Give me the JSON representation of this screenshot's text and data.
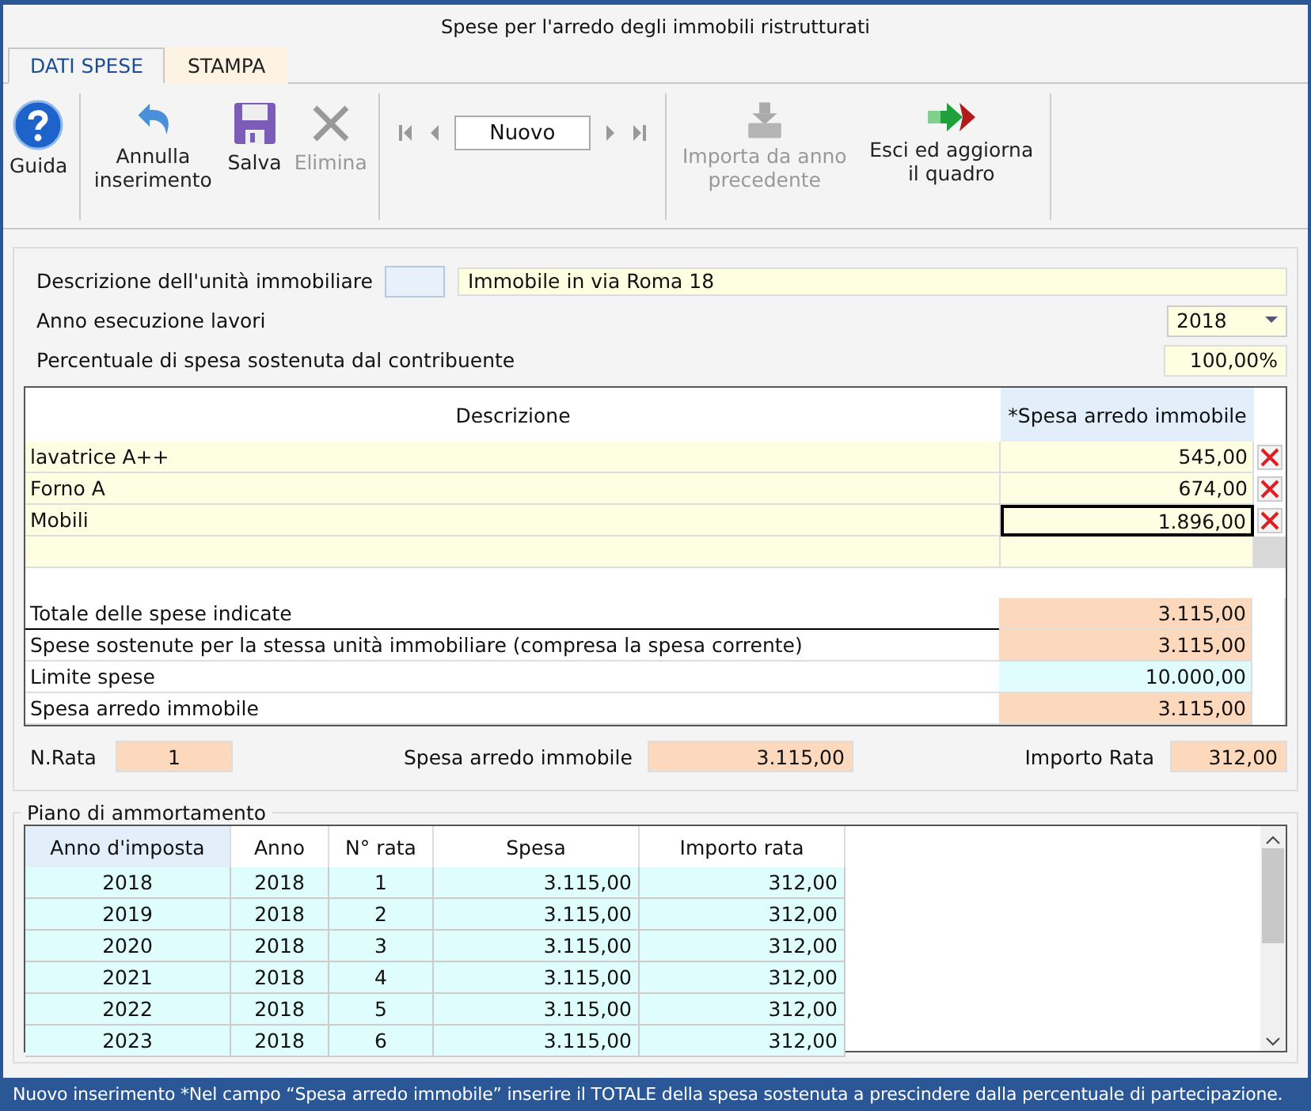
{
  "window": {
    "title": "Spese per l'arredo degli immobili ristrutturati"
  },
  "tabs": [
    {
      "label": "DATI SPESE",
      "selected": true
    },
    {
      "label": "STAMPA",
      "selected": false
    }
  ],
  "toolbar": [
    {
      "kind": "help",
      "label": "Guida",
      "disabled": false
    },
    {
      "kind": "undo",
      "label": "Annulla inserimento",
      "disabled": false
    },
    {
      "kind": "save",
      "label": "Salva",
      "disabled": false
    },
    {
      "kind": "delete",
      "label": "Elimina",
      "disabled": true
    },
    {
      "kind": "navigator",
      "record": "Nuovo"
    },
    {
      "kind": "import",
      "label": "Importa da anno precedente",
      "disabled": true
    },
    {
      "kind": "exit",
      "label": "Esci ed aggiorna il quadro",
      "disabled": false
    }
  ],
  "form": {
    "unit_label": "Descrizione dell'unità immobiliare",
    "unit_value": "Immobile in via Roma 18",
    "year_label": "Anno esecuzione lavori",
    "year_value": "2018",
    "percent_label": "Percentuale di spesa sostenuta dal contribuente",
    "percent_value": "100,00%"
  },
  "expenses": {
    "columns": [
      "Descrizione",
      "*Spesa arredo immobile"
    ],
    "rows": [
      {
        "description": "lavatrice A++",
        "amount": "545,00",
        "selected": false
      },
      {
        "description": "Forno A",
        "amount": "674,00",
        "selected": false
      },
      {
        "description": "Mobili",
        "amount": "1.896,00",
        "selected": true
      }
    ]
  },
  "totals": [
    {
      "label": "Totale delle spese indicate",
      "value": "3.115,00",
      "kind": "computed"
    },
    {
      "label": "Spese sostenute per la stessa unità immobiliare (compresa la spesa corrente)",
      "value": "3.115,00",
      "kind": "computed"
    },
    {
      "label": "Limite spese",
      "value": "10.000,00",
      "kind": "limit"
    },
    {
      "label": "Spesa arredo immobile",
      "value": "3.115,00",
      "kind": "computed"
    }
  ],
  "summary": {
    "rata_label": "N.Rata",
    "rata_value": "1",
    "spesa_label": "Spesa arredo immobile",
    "spesa_value": "3.115,00",
    "importo_label": "Importo Rata",
    "importo_value": "312,00"
  },
  "piano": {
    "title": "Piano di ammortamento",
    "columns": [
      "Anno d'imposta",
      "Anno",
      "N° rata",
      "Spesa",
      "Importo rata"
    ],
    "rows": [
      [
        "2018",
        "2018",
        "1",
        "3.115,00",
        "312,00"
      ],
      [
        "2019",
        "2018",
        "2",
        "3.115,00",
        "312,00"
      ],
      [
        "2020",
        "2018",
        "3",
        "3.115,00",
        "312,00"
      ],
      [
        "2021",
        "2018",
        "4",
        "3.115,00",
        "312,00"
      ],
      [
        "2022",
        "2018",
        "5",
        "3.115,00",
        "312,00"
      ],
      [
        "2023",
        "2018",
        "6",
        "3.115,00",
        "312,00"
      ]
    ]
  },
  "status_bar": "Nuovo inserimento  *Nel campo “Spesa arredo immobile” inserire il TOTALE della spesa sostenuta a prescindere dalla percentuale di partecipazione."
}
